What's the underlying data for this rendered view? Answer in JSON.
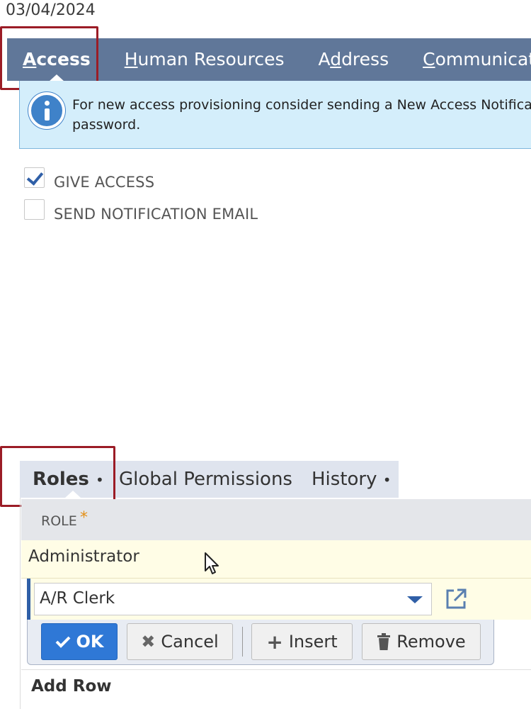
{
  "date": "03/04/2024",
  "top_tabs": [
    {
      "label": "Access",
      "underline_index": 0,
      "active": true
    },
    {
      "label": "Human Resources",
      "underline_index": 0,
      "active": false
    },
    {
      "label": "Address",
      "underline_index": 1,
      "active": false
    },
    {
      "label": "Communicati",
      "underline_index": 0,
      "active": false
    }
  ],
  "info_banner": {
    "line1": "For new access provisioning consider sending a New Access Notificatio",
    "line2": "password."
  },
  "checkboxes": [
    {
      "label": "GIVE ACCESS",
      "checked": true
    },
    {
      "label": "SEND NOTIFICATION EMAIL",
      "checked": false
    }
  ],
  "sub_tabs": [
    {
      "label": "Roles",
      "dot": "•",
      "active": true
    },
    {
      "label": "Global Permissions",
      "dot": "",
      "active": false
    },
    {
      "label": "History",
      "dot": "•",
      "active": false
    }
  ],
  "roles_table": {
    "column_header": "ROLE",
    "required_mark": "*",
    "rows": [
      "Administrator"
    ],
    "edit_row": {
      "selected_value": "A/R Clerk"
    }
  },
  "buttons": {
    "ok": "OK",
    "cancel": "Cancel",
    "insert": "Insert",
    "remove": "Remove"
  },
  "add_row": "Add Row",
  "colors": {
    "tab_bar": "#607799",
    "highlight": "#9b1c26",
    "info_bg": "#d4eefb",
    "ok_button": "#2f78d6",
    "accent": "#2f5fa7"
  }
}
